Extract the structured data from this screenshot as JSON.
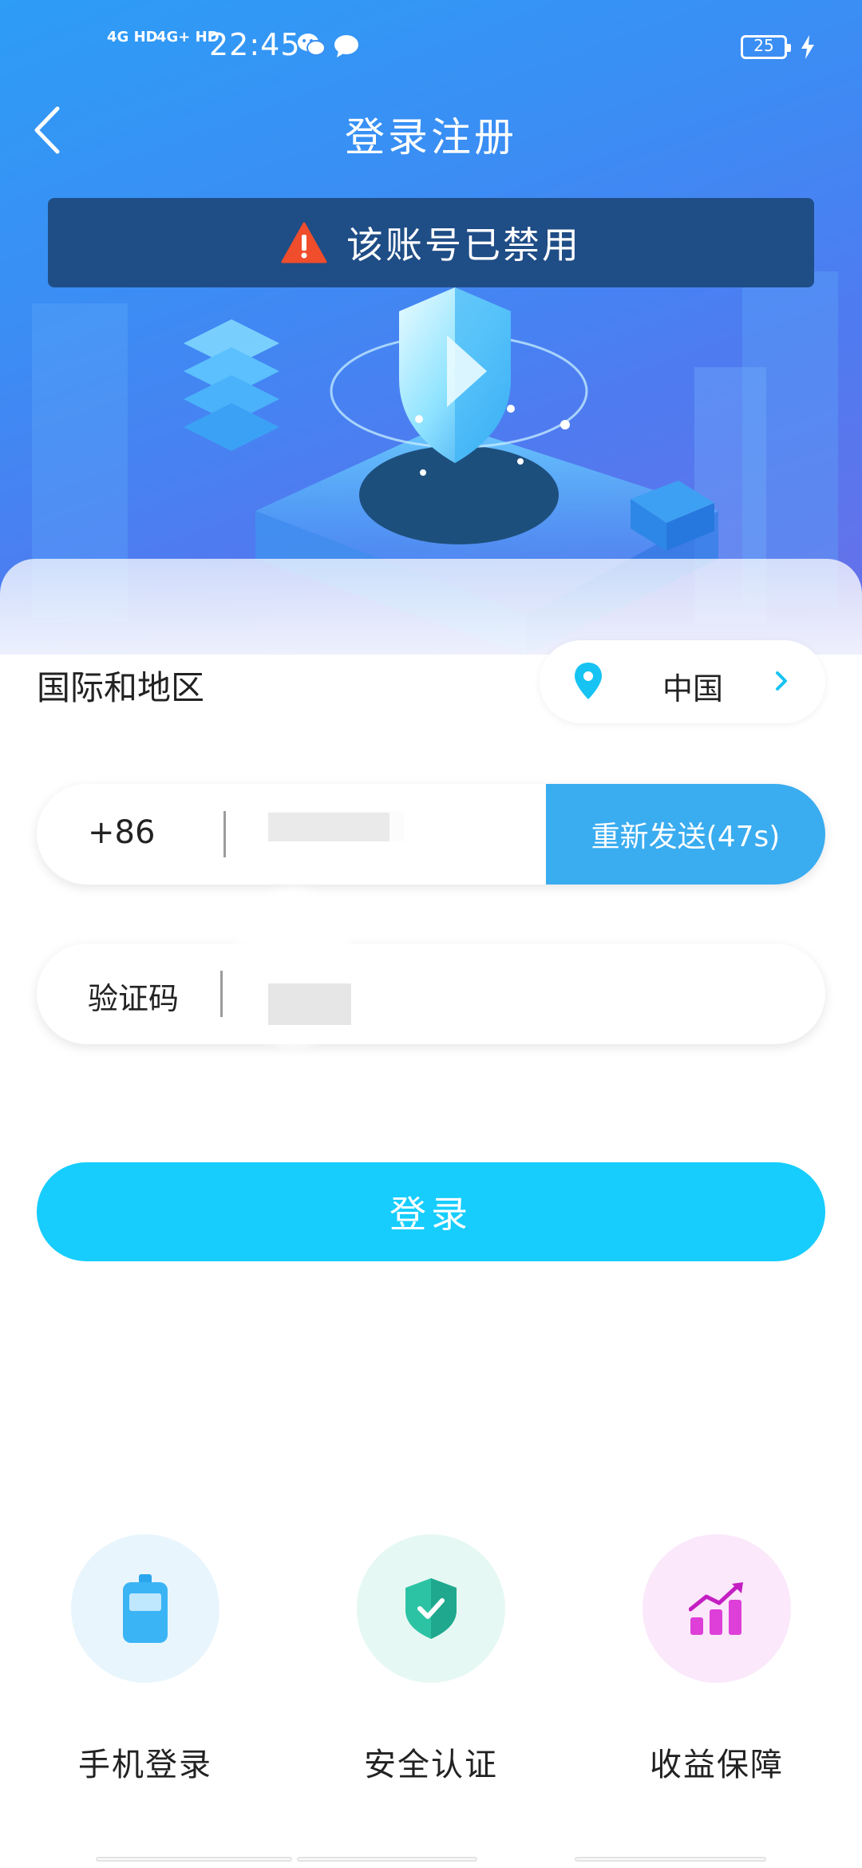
{
  "status_bar": {
    "signal_1": "4G HD",
    "signal_2": "4G+ HD",
    "time": "22:45",
    "battery": "25"
  },
  "header": {
    "title": "登录注册",
    "back_icon": "chevron-left-icon"
  },
  "banner": {
    "text": "该账号已禁用",
    "icon": "warning-icon"
  },
  "region": {
    "label": "国际和地区",
    "value": "中国"
  },
  "phone": {
    "country_code": "+86",
    "value": "",
    "resend_label": "重新发送(47s)"
  },
  "verification": {
    "label": "验证码",
    "value": ""
  },
  "login_button": {
    "label": "登录"
  },
  "features": [
    {
      "label": "手机登录",
      "icon": "phone-icon",
      "bg": "#e8f5fd",
      "accent": "#3bb4f5"
    },
    {
      "label": "安全认证",
      "icon": "shield-check-icon",
      "bg": "#e6f8f3",
      "accent": "#2cc3a4"
    },
    {
      "label": "收益保障",
      "icon": "growth-chart-icon",
      "bg": "#fbe8fb",
      "accent": "#dd3fd8"
    }
  ],
  "colors": {
    "accent": "#17cdfd",
    "resend": "#3aacf0",
    "banner_bg": "#1f4d86",
    "warning": "#ef4d2c"
  }
}
